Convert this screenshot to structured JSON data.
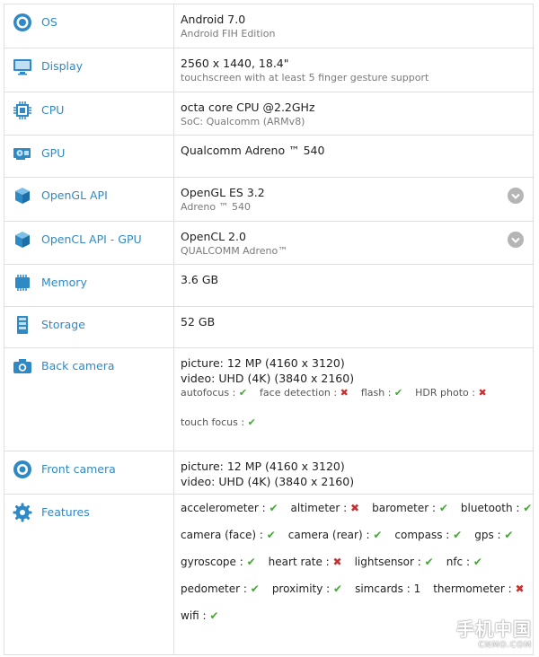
{
  "os": {
    "label": "OS",
    "main": "Android 7.0",
    "sub": "Android FIH Edition"
  },
  "display": {
    "label": "Display",
    "main": "2560 x 1440, 18.4\"",
    "sub": "touchscreen with at least 5 finger gesture support"
  },
  "cpu": {
    "label": "CPU",
    "main": "octa core CPU @2.2GHz",
    "sub": "SoC: Qualcomm (ARMv8)"
  },
  "gpu": {
    "label": "GPU",
    "main": "Qualcomm Adreno ™ 540"
  },
  "opengl": {
    "label": "OpenGL API",
    "main": "OpenGL ES 3.2",
    "sub": "Adreno ™ 540"
  },
  "opencl": {
    "label": "OpenCL API - GPU",
    "main": "OpenCL 2.0",
    "sub": "QUALCOMM Adreno™"
  },
  "memory": {
    "label": "Memory",
    "main": "3.6 GB"
  },
  "storage": {
    "label": "Storage",
    "main": "52 GB"
  },
  "back_camera": {
    "label": "Back camera",
    "picture": "picture: 12 MP (4160 x 3120)",
    "video": "video: UHD (4K) (3840 x 2160)",
    "f_autofocus": "autofocus :",
    "f_face": "face detection :",
    "f_flash": "flash :",
    "f_hdr": "HDR photo :",
    "f_touch": "touch focus :"
  },
  "front_camera": {
    "label": "Front camera",
    "picture": "picture: 12 MP (4160 x 3120)",
    "video": "video: UHD (4K) (3840 x 2160)"
  },
  "features": {
    "label": "Features",
    "accelerometer": "accelerometer :",
    "altimeter": "altimeter :",
    "barometer": "barometer :",
    "bluetooth": "bluetooth :",
    "camera_face": "camera (face) :",
    "camera_rear": "camera (rear) :",
    "compass": "compass :",
    "gps": "gps :",
    "gyroscope": "gyroscope :",
    "heart_rate": "heart rate :",
    "lightsensor": "lightsensor :",
    "nfc": "nfc :",
    "pedometer": "pedometer :",
    "proximity": "proximity :",
    "simcards": "simcards : 1",
    "thermometer": "thermometer :",
    "wifi": "wifi :"
  },
  "watermark": {
    "cn": "手机中国",
    "en": "CNMO.COM"
  },
  "colors": {
    "accent": "#2f89c5",
    "ok": "#44a733",
    "no": "#c63030"
  }
}
